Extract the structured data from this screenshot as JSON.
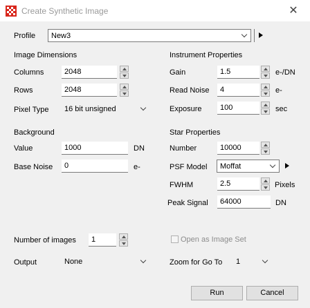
{
  "window": {
    "title": "Create Synthetic Image",
    "close_glyph": "✕"
  },
  "profile": {
    "label": "Profile",
    "value": "New3"
  },
  "image_dimensions": {
    "header": "Image Dimensions",
    "columns_label": "Columns",
    "columns_value": "2048",
    "rows_label": "Rows",
    "rows_value": "2048",
    "pixel_type_label": "Pixel Type",
    "pixel_type_value": "16 bit unsigned"
  },
  "background": {
    "header": "Background",
    "value_label": "Value",
    "value_value": "1000",
    "value_unit": "DN",
    "base_noise_label": "Base Noise",
    "base_noise_value": "0",
    "base_noise_unit": "e-"
  },
  "instrument": {
    "header": "Instrument Properties",
    "gain_label": "Gain",
    "gain_value": "1.5",
    "gain_unit": "e-/DN",
    "read_noise_label": "Read Noise",
    "read_noise_value": "4",
    "read_noise_unit": "e-",
    "exposure_label": "Exposure",
    "exposure_value": "100",
    "exposure_unit": "sec"
  },
  "star": {
    "header": "Star Properties",
    "number_label": "Number",
    "number_value": "10000",
    "psf_label": "PSF Model",
    "psf_value": "Moffat",
    "fwhm_label": "FWHM",
    "fwhm_value": "2.5",
    "fwhm_unit": "Pixels",
    "peak_label": "Peak Signal",
    "peak_value": "64000",
    "peak_unit": "DN"
  },
  "bottom": {
    "num_images_label": "Number of images",
    "num_images_value": "1",
    "open_as_set_label": "Open as Image Set",
    "output_label": "Output",
    "output_value": "None",
    "zoom_label": "Zoom for Go To",
    "zoom_value": "1"
  },
  "buttons": {
    "run": "Run",
    "cancel": "Cancel"
  },
  "colors": {
    "window_bg": "#f0f0f0",
    "icon_red": "#d9261c",
    "disabled_text": "#8c8c8c"
  }
}
